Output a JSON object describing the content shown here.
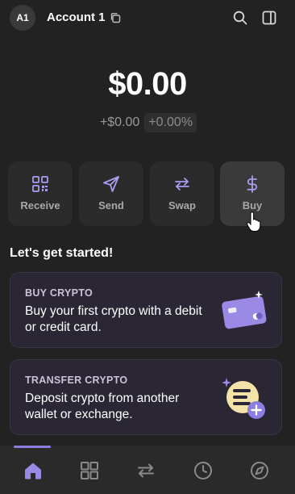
{
  "header": {
    "avatar_initials": "A1",
    "account_name": "Account 1",
    "icons": [
      "copy-icon",
      "search-icon",
      "side-panel-icon"
    ]
  },
  "balance": {
    "total": "$0.00",
    "change_abs": "+$0.00",
    "change_pct": "+0.00%"
  },
  "actions": [
    {
      "label": "Receive",
      "icon": "qr-code-icon"
    },
    {
      "label": "Send",
      "icon": "send-icon"
    },
    {
      "label": "Swap",
      "icon": "swap-icon"
    },
    {
      "label": "Buy",
      "icon": "dollar-icon"
    }
  ],
  "get_started": {
    "title": "Let's get started!",
    "cards": [
      {
        "kicker": "BUY CRYPTO",
        "body": "Buy your first crypto with a debit or credit card.",
        "icon": "credit-card-icon"
      },
      {
        "kicker": "TRANSFER CRYPTO",
        "body": "Deposit crypto from another wallet or exchange.",
        "icon": "deposit-icon"
      }
    ]
  },
  "bottom_nav": {
    "items": [
      "home-icon",
      "apps-grid-icon",
      "activity-swap-icon",
      "history-clock-icon",
      "explore-compass-icon"
    ],
    "active_index": 0
  },
  "colors": {
    "accent": "#8c7ee0",
    "background": "#222222",
    "card_bg": "#2a2633"
  }
}
